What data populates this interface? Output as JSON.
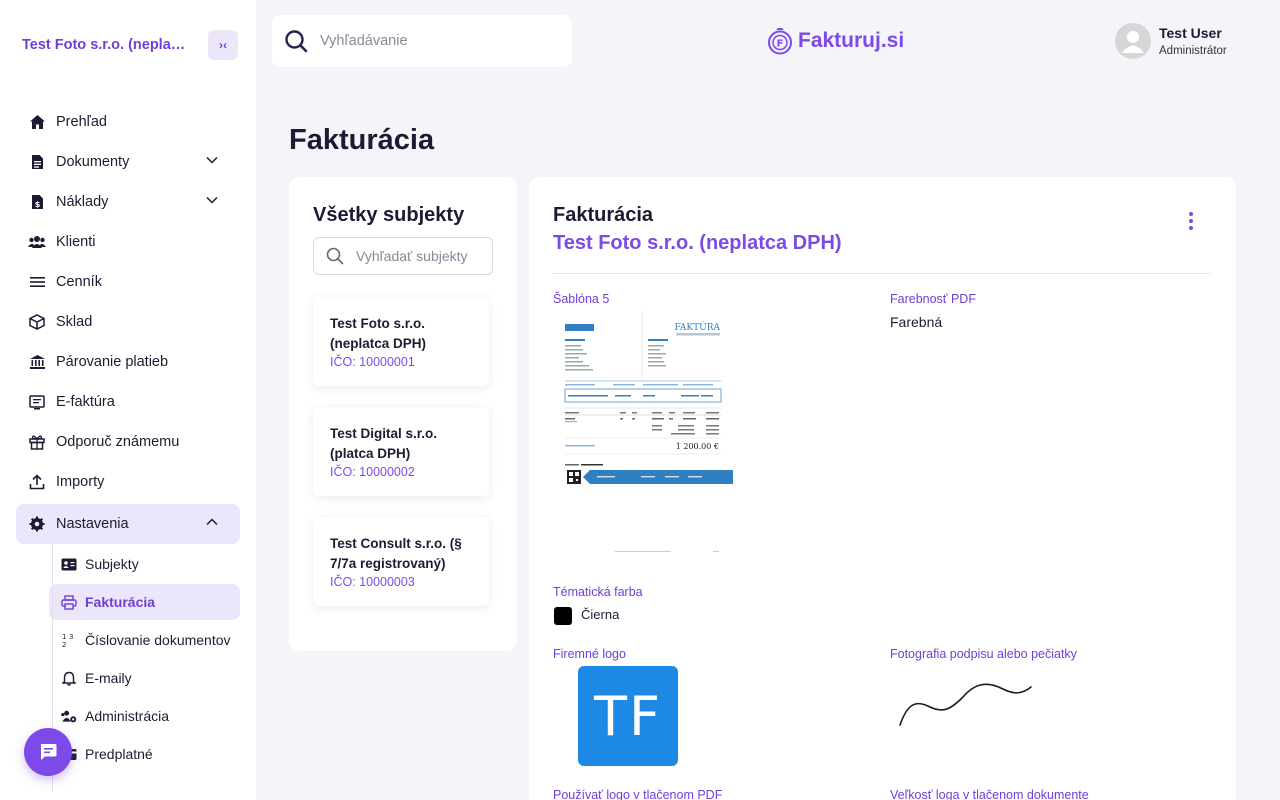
{
  "sidebar": {
    "company_name": "Test Foto s.r.o. (neplatca DPH)",
    "collapse_glyph": "›‹",
    "items": [
      {
        "label": "Prehľad",
        "icon": "home-icon"
      },
      {
        "label": "Dokumenty",
        "icon": "document-icon"
      },
      {
        "label": "Náklady",
        "icon": "expense-icon"
      },
      {
        "label": "Klienti",
        "icon": "clients-icon"
      },
      {
        "label": "Cenník",
        "icon": "list-icon"
      },
      {
        "label": "Sklad",
        "icon": "box-icon"
      },
      {
        "label": "Párovanie platieb",
        "icon": "bank-icon"
      },
      {
        "label": "E-faktúra",
        "icon": "einvoice-icon"
      },
      {
        "label": "Odporuč známemu",
        "icon": "gift-icon"
      },
      {
        "label": "Importy",
        "icon": "upload-icon"
      },
      {
        "label": "Nastavenia",
        "icon": "settings-icon"
      }
    ],
    "settings_sub": [
      {
        "label": "Subjekty",
        "icon": "id-card-icon"
      },
      {
        "label": "Fakturácia",
        "icon": "printer-icon"
      },
      {
        "label": "Číslovanie dokumentov",
        "icon": "numbering-icon"
      },
      {
        "label": "E-maily",
        "icon": "bell-icon"
      },
      {
        "label": "Administrácia",
        "icon": "users-gear-icon"
      },
      {
        "label": "Predplatné",
        "icon": "card-icon"
      }
    ]
  },
  "header": {
    "search_placeholder": "Vyhľadávanie",
    "brand": "Fakturuj.si",
    "user_name": "Test User",
    "user_role": "Administrátor"
  },
  "page": {
    "title": "Fakturácia"
  },
  "subjects": {
    "title": "Všetky subjekty",
    "search_placeholder": "Vyhľadať subjekty",
    "items": [
      {
        "name": "Test Foto s.r.o. (neplatca DPH)",
        "ico": "IČO: 10000001"
      },
      {
        "name": "Test Digital s.r.o. (platca DPH)",
        "ico": "IČO: 10000002"
      },
      {
        "name": "Test Consult s.r.o. (§ 7/7a registrovaný)",
        "ico": "IČO: 10000003"
      }
    ]
  },
  "invoicing": {
    "title": "Fakturácia",
    "subject": "Test Foto s.r.o. (neplatca DPH)",
    "template_label": "Šablóna 5",
    "template_heading": "FAKTÚRA",
    "template_total": "1 200.00 €",
    "pdf_color_label": "Farebnosť PDF",
    "pdf_color_value": "Farebná",
    "theme_color_label": "Tématická farba",
    "theme_color_value": "Čierna",
    "theme_color_hex": "#000000",
    "logo_label": "Firemné logo",
    "logo_text": "TF",
    "logo_color": "#1e88e5",
    "signature_label": "Fotografia podpisu alebo pečiatky",
    "use_logo_label": "Používať logo v tlačenom PDF",
    "logo_size_label": "Veľkosť loga v tlačenom dokumente"
  },
  "colors": {
    "accent": "#7c4ae8",
    "accent_light": "#ece6fb"
  }
}
